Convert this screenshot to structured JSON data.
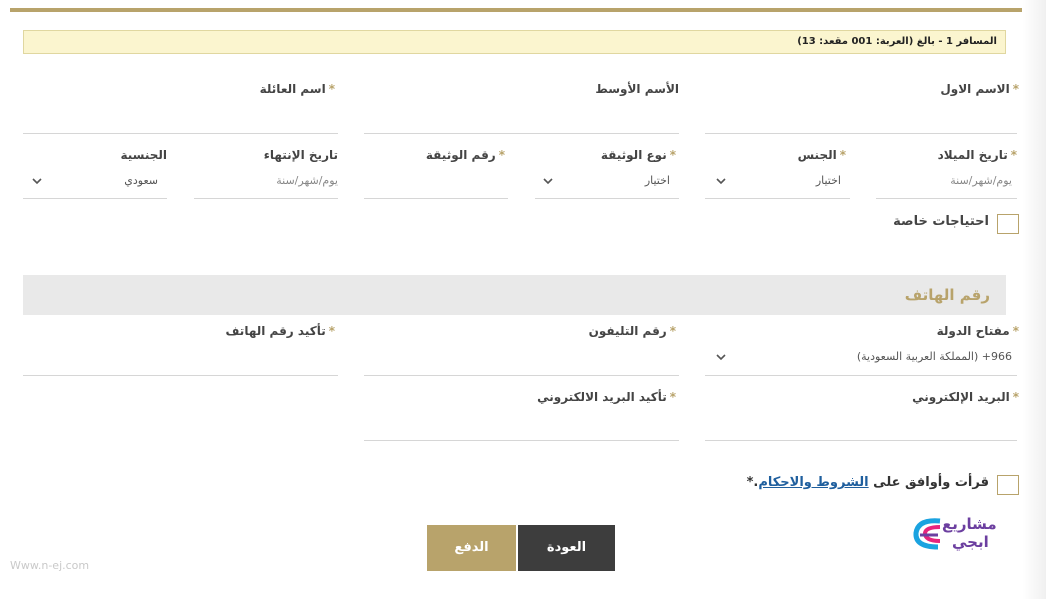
{
  "banner": {
    "text": "المسافر 1 - بالغ (العربة: 001 مقعد: 13)"
  },
  "personal": {
    "first_name": {
      "label": "الاسم الاول",
      "required": "*",
      "value": ""
    },
    "middle_name": {
      "label": "الأسم الأوسط",
      "value": ""
    },
    "family_name": {
      "label": "اسم العائلة",
      "required": "*",
      "value": ""
    },
    "birth_date": {
      "label": "تاريخ الميلاد",
      "required": "*",
      "placeholder": "يوم/شهر/سنة"
    },
    "gender": {
      "label": "الجنس",
      "required": "*",
      "selected": "اختيار"
    },
    "doc_type": {
      "label": "نوع الوثيقة",
      "required": "*",
      "selected": "اختيار"
    },
    "doc_number": {
      "label": "رقم الوثيقة",
      "required": "*",
      "value": ""
    },
    "expiry_date": {
      "label": "تاريخ الإنتهاء",
      "placeholder": "يوم/شهر/سنة"
    },
    "nationality": {
      "label": "الجنسية",
      "selected": "سعودي"
    },
    "special_needs": {
      "label": "احتياجات خاصة"
    }
  },
  "phone_section": {
    "title": "رقم الهاتف"
  },
  "contact": {
    "country_code": {
      "label": "مفتاح الدولة",
      "required": "*",
      "code": "966+",
      "country": "(المملكة العربية السعودية)"
    },
    "phone": {
      "label": "رقم التليفون",
      "required": "*",
      "value": ""
    },
    "phone_confirm": {
      "label": "تأكيد رقم الهاتف",
      "required": "*",
      "value": ""
    },
    "email": {
      "label": "البريد الإلكتروني",
      "required": "*",
      "value": ""
    },
    "email_confirm": {
      "label": "تأكيد البريد الالكتروني",
      "required": "*",
      "value": ""
    }
  },
  "terms": {
    "prefix": "قرأت وأوافق على",
    "link": "الشروط والاحكام",
    "suffix": ".*"
  },
  "buttons": {
    "back": "العودة",
    "pay": "الدفع"
  },
  "logo": {
    "line1": "مشاريع",
    "line2": "ابجي",
    "colors": [
      "#e6257d",
      "#1ba3e0",
      "#6c3fa0"
    ]
  },
  "watermark": {
    "text": "Www.n-ej.com"
  },
  "colors": {
    "accent": "#b8a36b",
    "banner_bg": "#fbf5cf",
    "back_button": "#3d3d3d",
    "link": "#1f5f9e"
  }
}
